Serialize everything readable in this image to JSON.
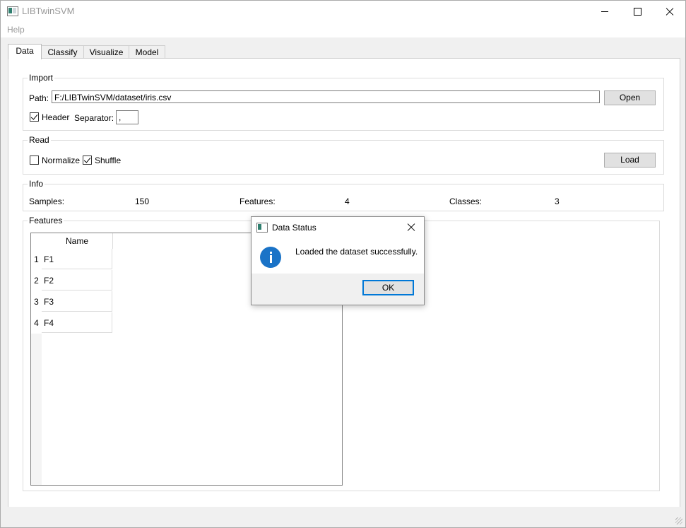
{
  "window": {
    "title": "LIBTwinSVM"
  },
  "menu": {
    "help": "Help"
  },
  "tabs": [
    {
      "label": "Data",
      "active": true
    },
    {
      "label": "Classify",
      "active": false
    },
    {
      "label": "Visualize",
      "active": false
    },
    {
      "label": "Model",
      "active": false
    }
  ],
  "import": {
    "title": "Import",
    "path_label": "Path:",
    "path_value": "F:/LIBTwinSVM/dataset/iris.csv",
    "open_label": "Open",
    "header_label": "Header",
    "header_checked": true,
    "separator_label": "Separator:",
    "separator_value": ","
  },
  "read": {
    "title": "Read",
    "normalize_label": "Normalize",
    "normalize_checked": false,
    "shuffle_label": "Shuffle",
    "shuffle_checked": true,
    "load_label": "Load"
  },
  "info": {
    "title": "Info",
    "samples_label": "Samples:",
    "samples_value": "150",
    "features_label": "Features:",
    "features_value": "4",
    "classes_label": "Classes:",
    "classes_value": "3"
  },
  "features": {
    "title": "Features",
    "column_header": "Name",
    "rows": [
      {
        "num": "1",
        "name": "F1"
      },
      {
        "num": "2",
        "name": "F2"
      },
      {
        "num": "3",
        "name": "F3"
      },
      {
        "num": "4",
        "name": "F4"
      }
    ]
  },
  "dialog": {
    "title": "Data Status",
    "message": "Loaded the dataset successfully.",
    "ok_label": "OK",
    "icon": "info-icon"
  },
  "colors": {
    "accent": "#0078d7",
    "info_icon": "#1a73c7"
  }
}
